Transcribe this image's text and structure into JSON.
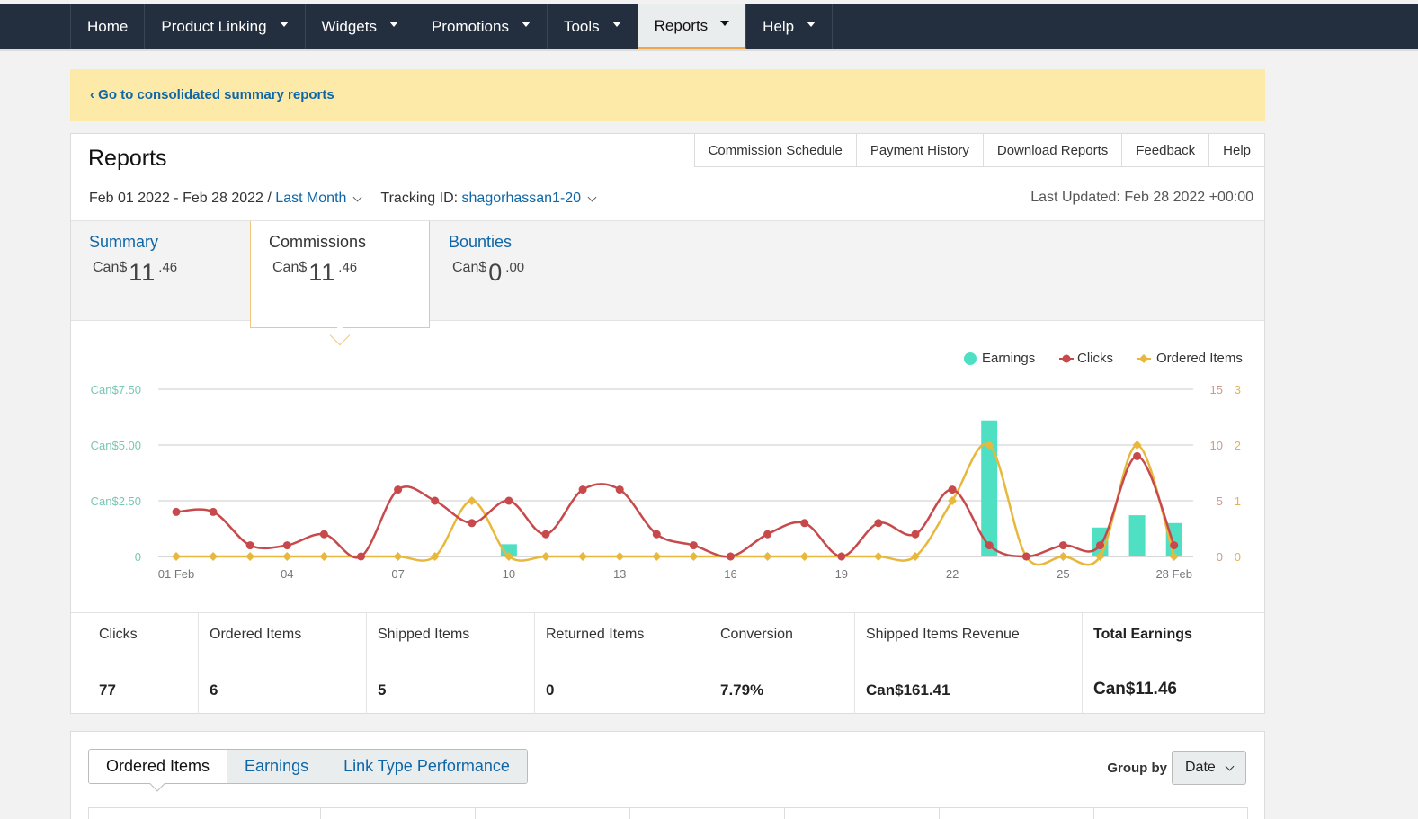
{
  "nav": {
    "items": [
      {
        "label": "Home",
        "caret": false
      },
      {
        "label": "Product Linking",
        "caret": true
      },
      {
        "label": "Widgets",
        "caret": true
      },
      {
        "label": "Promotions",
        "caret": true
      },
      {
        "label": "Tools",
        "caret": true
      },
      {
        "label": "Reports",
        "caret": true,
        "active": true
      },
      {
        "label": "Help",
        "caret": true
      }
    ]
  },
  "banner": {
    "link": "‹ Go to consolidated summary reports"
  },
  "reports": {
    "title": "Reports",
    "tabs": [
      "Commission Schedule",
      "Payment History",
      "Download Reports",
      "Feedback",
      "Help"
    ],
    "date_range": "Feb 01 2022 - Feb 28 2022 /",
    "period": "Last Month",
    "tracking_label": "Tracking ID:",
    "tracking_id": "shagorhassan1-20",
    "last_updated": "Last Updated: Feb 28 2022 +00:00"
  },
  "summary": [
    {
      "label": "Summary",
      "currency": "Can$",
      "whole": "11",
      "decimal": ".46"
    },
    {
      "label": "Commissions",
      "currency": "Can$",
      "whole": "11",
      "decimal": ".46"
    },
    {
      "label": "Bounties",
      "currency": "Can$",
      "whole": "0",
      "decimal": ".00"
    }
  ],
  "legend": [
    "Earnings",
    "Clicks",
    "Ordered Items"
  ],
  "colors": {
    "earnings": "#4fe0c4",
    "clicks": "#c8494b",
    "ordered": "#e8b83c",
    "link": "#0f66a6",
    "nav_bg": "#232f3e",
    "banner": "#fdeaa8"
  },
  "chart_data": {
    "type": "bar",
    "x": [
      "01 Feb",
      "02",
      "03",
      "04",
      "05",
      "06",
      "07",
      "08",
      "09",
      "10",
      "11",
      "12",
      "13",
      "14",
      "15",
      "16",
      "17",
      "18",
      "19",
      "20",
      "21",
      "22",
      "23",
      "24",
      "25",
      "26",
      "27",
      "28 Feb"
    ],
    "x_tick_labels": [
      "01 Feb",
      "04",
      "07",
      "10",
      "13",
      "16",
      "19",
      "22",
      "25",
      "28 Feb"
    ],
    "y_left_ticks": [
      "0",
      "Can$2.50",
      "Can$5.00",
      "Can$7.50"
    ],
    "y_left_lim": [
      0,
      7.5
    ],
    "y_right1_ticks": [
      "0",
      "5",
      "10",
      "15"
    ],
    "y_right1_lim": [
      0,
      15
    ],
    "y_right2_ticks": [
      "0",
      "1",
      "2",
      "3"
    ],
    "y_right2_lim": [
      0,
      3
    ],
    "series": [
      {
        "name": "Earnings",
        "type": "bar",
        "axis": "left",
        "values": [
          0,
          0,
          0,
          0,
          0,
          0,
          0,
          0,
          0,
          0.55,
          0,
          0,
          0,
          0,
          0,
          0,
          0,
          0,
          0,
          0,
          0,
          0,
          6.1,
          0,
          0,
          1.3,
          1.85,
          1.5
        ]
      },
      {
        "name": "Clicks",
        "type": "line",
        "axis": "right1",
        "values": [
          4,
          4,
          1,
          1,
          2,
          0,
          6,
          5,
          3,
          5,
          2,
          6,
          6,
          2,
          1,
          0,
          2,
          3,
          0,
          3,
          2,
          6,
          1,
          0,
          1,
          1,
          9,
          1
        ]
      },
      {
        "name": "Ordered Items",
        "type": "line",
        "axis": "right2",
        "values": [
          0,
          0,
          0,
          0,
          0,
          0,
          0,
          0,
          1,
          0,
          0,
          0,
          0,
          0,
          0,
          0,
          0,
          0,
          0,
          0,
          0,
          1,
          2,
          0,
          0,
          0,
          2,
          0
        ]
      }
    ],
    "grid": true,
    "legend_position": "top-right"
  },
  "metrics": [
    {
      "label": "Clicks",
      "value": "77"
    },
    {
      "label": "Ordered Items",
      "value": "6"
    },
    {
      "label": "Shipped Items",
      "value": "5"
    },
    {
      "label": "Returned Items",
      "value": "0"
    },
    {
      "label": "Conversion",
      "value": "7.79%"
    },
    {
      "label": "Shipped Items Revenue",
      "value": "Can$161.41"
    },
    {
      "label": "Total Earnings",
      "value": "Can$11.46"
    }
  ],
  "bottom": {
    "tabs": [
      "Ordered Items",
      "Earnings",
      "Link Type Performance"
    ],
    "group_by_label": "Group by",
    "group_by_value": "Date"
  }
}
